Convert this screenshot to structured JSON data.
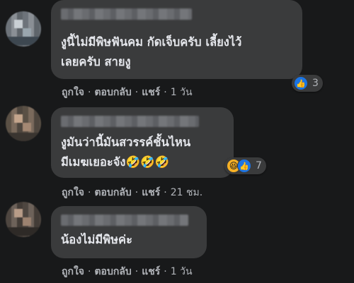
{
  "comments": [
    {
      "lines": [
        "งูนี้ไม่มีพิษฟันคม กัดเจ็บครับ เลี้ยงไว้",
        "เลยครับ สายงู"
      ],
      "reactions": {
        "count": "3",
        "icons": [
          "like-icon"
        ]
      },
      "actions": {
        "like": "ถูกใจ",
        "reply": "ตอบกลับ",
        "share": "แชร์",
        "time": "1 วัน"
      }
    },
    {
      "lines": [
        "งูมันว่านี้มันสวรรค์ชั้นไหน",
        "มีเมฆเยอะจัง"
      ],
      "emoji": "🤣🤣🤣",
      "reactions": {
        "count": "7",
        "icons": [
          "haha-icon",
          "like-icon"
        ]
      },
      "actions": {
        "like": "ถูกใจ",
        "reply": "ตอบกลับ",
        "share": "แชร์",
        "time": "21 ชม."
      }
    },
    {
      "lines": [
        "น้องไม่มีพิษค่ะ"
      ],
      "actions": {
        "like": "ถูกใจ",
        "reply": "ตอบกลับ",
        "share": "แชร์",
        "time": "1 วัน"
      }
    }
  ],
  "icons": {
    "like": "👍",
    "haha": "😆"
  },
  "separator": "·",
  "colors": {
    "background": "#18191a",
    "bubble": "#3a3b3c",
    "text": "#e4e6eb",
    "muted": "#b0b3b8",
    "like_blue": "#1b74e4"
  }
}
